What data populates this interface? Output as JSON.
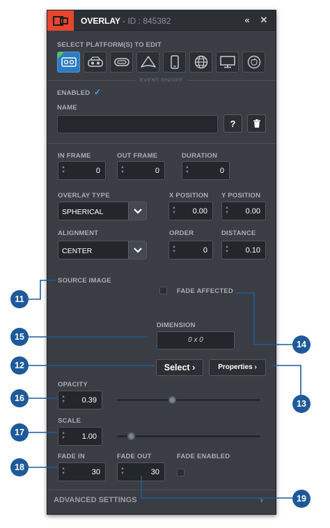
{
  "window": {
    "title": "OVERLAY",
    "id_text": "- ID : 845382",
    "collapse_icon": "double-chevron-left-icon",
    "close_icon": "close-icon"
  },
  "platforms": {
    "label": "SELECT PLATFORM(S) TO EDIT",
    "items": [
      {
        "icon": "vr-headset-active-icon",
        "active": true
      },
      {
        "icon": "vr-goggles-icon",
        "active": false
      },
      {
        "icon": "cardboard-icon",
        "active": false
      },
      {
        "icon": "triangle-headset-icon",
        "active": false
      },
      {
        "icon": "mobile-phone-icon",
        "active": false
      },
      {
        "icon": "web-globe-icon",
        "active": false
      },
      {
        "icon": "desktop-monitor-icon",
        "active": false
      },
      {
        "icon": "apple-tv-icon",
        "active": false
      }
    ]
  },
  "event_label": "EVENT ON/OFF",
  "enabled": {
    "label": "ENABLED",
    "mark": "✓"
  },
  "name": {
    "label": "NAME",
    "value": "",
    "help_label": "?",
    "delete_icon": "trash-icon"
  },
  "timing": {
    "in_frame": {
      "label": "IN FRAME",
      "value": "0"
    },
    "out_frame": {
      "label": "OUT FRAME",
      "value": "0"
    },
    "duration": {
      "label": "DURATION",
      "value": "0"
    }
  },
  "overlay_type": {
    "label": "OVERLAY TYPE",
    "value": "SPHERICAL"
  },
  "x_position": {
    "label": "X POSITION",
    "value": "0.00"
  },
  "y_position": {
    "label": "Y POSITION",
    "value": "0.00"
  },
  "alignment": {
    "label": "ALIGNMENT",
    "value": "CENTER"
  },
  "order": {
    "label": "ORDER",
    "value": "0"
  },
  "distance": {
    "label": "DISTANCE",
    "value": "0.10"
  },
  "source_image": {
    "label": "SOURCE IMAGE"
  },
  "fade_affected": {
    "label": "FADE AFFECTED"
  },
  "dimension": {
    "label": "DIMENSION",
    "value": "0 x 0"
  },
  "actions": {
    "select_label": "Select ›",
    "properties_label": "Properties ›"
  },
  "opacity": {
    "label": "OPACITY",
    "value": "0.39",
    "level": 0.39
  },
  "scale": {
    "label": "SCALE",
    "value": "1.00",
    "level": 0.1
  },
  "fade_in": {
    "label": "FADE IN",
    "value": "30"
  },
  "fade_out": {
    "label": "FADE OUT",
    "value": "30"
  },
  "fade_enabled": {
    "label": "FADE ENABLED"
  },
  "advanced": {
    "label": "ADVANCED SETTINGS",
    "arrow": "›"
  },
  "callouts": [
    "11",
    "12",
    "13",
    "14",
    "15",
    "16",
    "17",
    "18",
    "19"
  ],
  "colors": {
    "accent": "#e8452f",
    "callout": "#1e5a99",
    "active_platform": "#2e7bbf",
    "panel": "#3a3e44"
  }
}
